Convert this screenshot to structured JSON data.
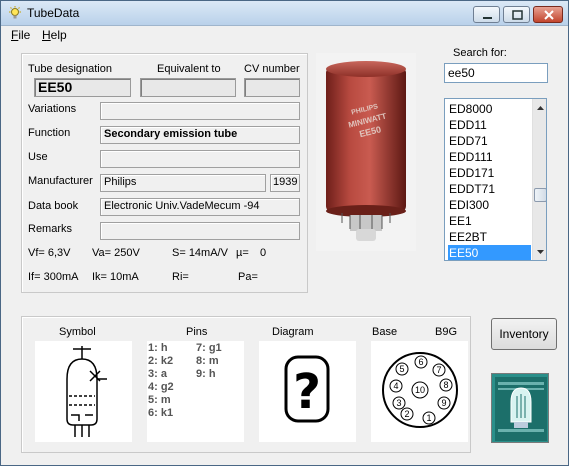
{
  "window": {
    "title": "TubeData"
  },
  "menu": [
    {
      "hot": "F",
      "rest": "ile"
    },
    {
      "hot": "H",
      "rest": "elp"
    }
  ],
  "labels": {
    "tube_designation": "Tube designation",
    "equivalent_to": "Equivalent to",
    "cv_number": "CV number",
    "variations": "Variations",
    "function": "Function",
    "use": "Use",
    "manufacturer": "Manufacturer",
    "data_book": "Data book",
    "remarks": "Remarks",
    "search_for": "Search for:"
  },
  "fields": {
    "tube_designation": "EE50",
    "equivalent_to": "",
    "cv_number": "",
    "variations": "",
    "function": "Secondary emission tube",
    "use": "",
    "manufacturer": "Philips",
    "year": "1939",
    "data_book": "Electronic Univ.VadeMecum -94",
    "remarks": ""
  },
  "parameters": {
    "vf": "Vf= 6,3V",
    "va": "Va= 250V",
    "s": "S= 14mA/V",
    "mu": "µ=",
    "mu_value": "0",
    "if": "If= 300mA",
    "ik": "Ik= 10mA",
    "ri": "Ri=",
    "pa": "Pa="
  },
  "search": {
    "value": "ee50"
  },
  "tube_list": {
    "items": [
      "ED8000",
      "EDD11",
      "EDD71",
      "EDD111",
      "EDD171",
      "EDDT71",
      "EDI300",
      "EE1",
      "EE2BT",
      "EE50"
    ],
    "selected": "EE50"
  },
  "bottom": {
    "symbol_label": "Symbol",
    "pins_label": "Pins",
    "diagram_label": "Diagram",
    "base_label": "Base",
    "base_type": "B9G",
    "pins_col1": [
      "1: h",
      "2: k2",
      "3: a",
      "4: g2",
      "5: m",
      "6: k1"
    ],
    "pins_col2": [
      "7: g1",
      "8: m",
      "9: h"
    ],
    "diagram_glyph": "?",
    "base_pins": [
      "1",
      "2",
      "3",
      "4",
      "5",
      "6",
      "7",
      "8",
      "9",
      "10"
    ],
    "inventory_button": "Inventory"
  },
  "tube_photo_text": [
    "PHILIPS",
    "MINIWATT",
    "EE50"
  ],
  "colors": {
    "selection": "#3399ff",
    "tube_body": "#a63b33",
    "logo_bg": "#2a8f8a"
  }
}
